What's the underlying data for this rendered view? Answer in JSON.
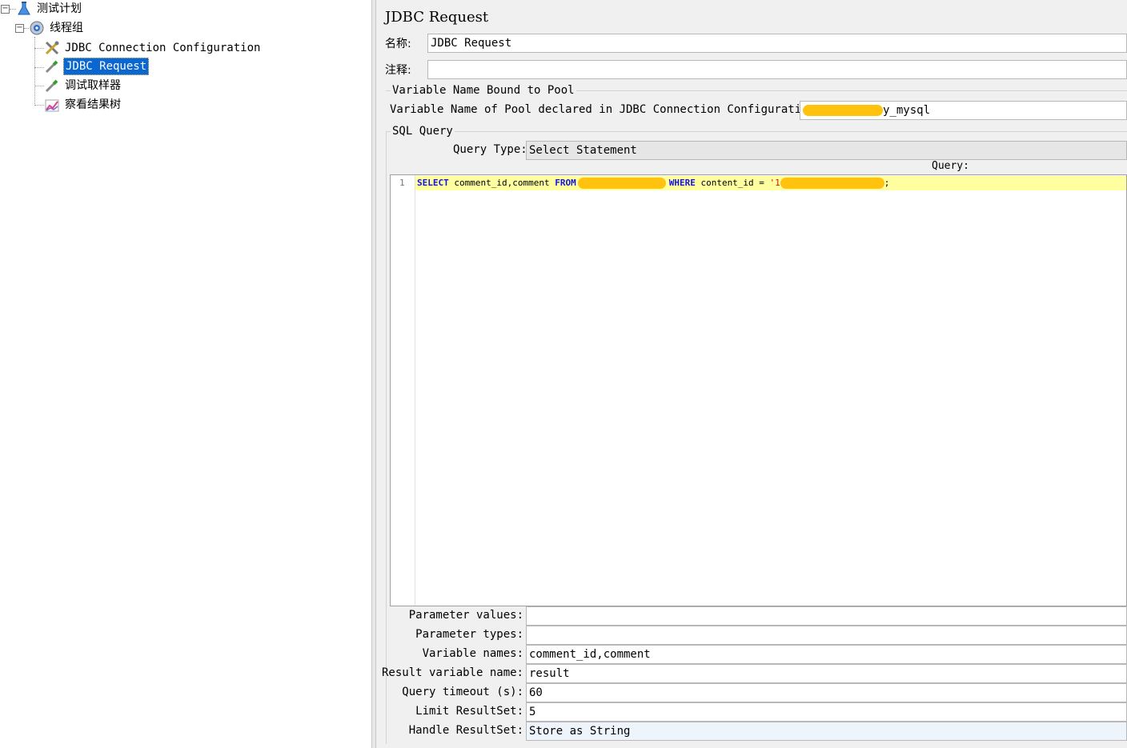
{
  "tree": {
    "items": [
      {
        "label": "测试计划",
        "icon": "test-plan-icon"
      },
      {
        "label": "线程组",
        "icon": "thread-group-icon"
      },
      {
        "label": "JDBC Connection Configuration",
        "icon": "tools-icon"
      },
      {
        "label": "JDBC Request",
        "icon": "pipette-icon",
        "selected": true
      },
      {
        "label": "调试取样器",
        "icon": "pipette-icon"
      },
      {
        "label": "察看结果树",
        "icon": "chart-icon"
      }
    ]
  },
  "panel": {
    "title": "JDBC Request",
    "name_label": "名称:",
    "name_value": "JDBC Request",
    "comment_label": "注释:",
    "comment_value": "",
    "pool_group_title": "Variable Name Bound to Pool",
    "pool_label": "Variable Name of Pool declared in JDBC Connection Configuration:",
    "pool_value_suffix": "y_mysql",
    "sql_group_title": "SQL Query",
    "query_type_label": "Query Type:",
    "query_type_value": "Select Statement",
    "query_label": "Query:",
    "code": {
      "line_number": "1",
      "kw_select": "SELECT",
      "cols": " comment_id,comment ",
      "kw_from": "FROM",
      "kw_where": "WHERE",
      "cond": " content_id = ",
      "str_start": "'1",
      "end": ";"
    },
    "params": [
      {
        "label": "Parameter values:",
        "value": ""
      },
      {
        "label": "Parameter types:",
        "value": ""
      },
      {
        "label": "Variable names:",
        "value": "comment_id,comment"
      },
      {
        "label": "Result variable name:",
        "value": "result"
      },
      {
        "label": "Query timeout (s):",
        "value": "60"
      },
      {
        "label": "Limit ResultSet:",
        "value": "5"
      },
      {
        "label": "Handle ResultSet:",
        "value": "Store as String"
      }
    ]
  },
  "colors": {
    "selection": "#0a66d1",
    "redaction": "#ffc20e",
    "keyword": "#1414d8",
    "string": "#d21414",
    "current_line": "#ffffa0"
  }
}
